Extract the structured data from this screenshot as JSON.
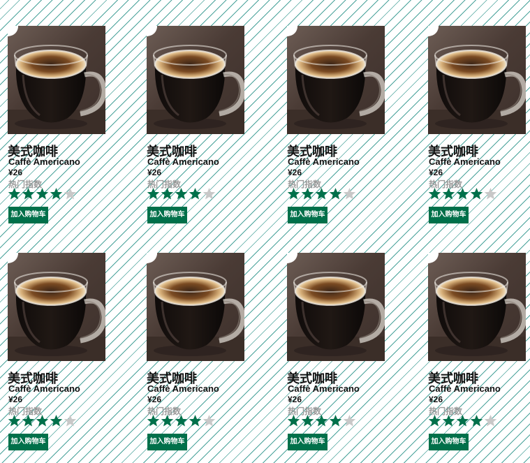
{
  "colors": {
    "accent": "#00704a",
    "star_filled": "#00704a",
    "star_empty": "#c8c8c8",
    "stripe": "#4aa39b"
  },
  "products": [
    {
      "name_cn": "美式咖啡",
      "name_en": "Caffè Americano",
      "price": "¥26",
      "hot_label": "热门指数",
      "rating": 4,
      "max_rating": 5,
      "cart_label": "加入购物车",
      "image_icon": "coffee-cup-photo"
    },
    {
      "name_cn": "美式咖啡",
      "name_en": "Caffè Americano",
      "price": "¥26",
      "hot_label": "热门指数",
      "rating": 4,
      "max_rating": 5,
      "cart_label": "加入购物车",
      "image_icon": "coffee-cup-photo"
    },
    {
      "name_cn": "美式咖啡",
      "name_en": "Caffè Americano",
      "price": "¥26",
      "hot_label": "热门指数",
      "rating": 4,
      "max_rating": 5,
      "cart_label": "加入购物车",
      "image_icon": "coffee-cup-photo"
    },
    {
      "name_cn": "美式咖啡",
      "name_en": "Caffè Americano",
      "price": "¥26",
      "hot_label": "热门指数",
      "rating": 4,
      "max_rating": 5,
      "cart_label": "加入购物车",
      "image_icon": "coffee-cup-photo"
    },
    {
      "name_cn": "美式咖啡",
      "name_en": "Caffè Americano",
      "price": "¥26",
      "hot_label": "热门指数",
      "rating": 4,
      "max_rating": 5,
      "cart_label": "加入购物车",
      "image_icon": "coffee-cup-photo"
    },
    {
      "name_cn": "美式咖啡",
      "name_en": "Caffè Americano",
      "price": "¥26",
      "hot_label": "热门指数",
      "rating": 4,
      "max_rating": 5,
      "cart_label": "加入购物车",
      "image_icon": "coffee-cup-photo"
    },
    {
      "name_cn": "美式咖啡",
      "name_en": "Caffè Americano",
      "price": "¥26",
      "hot_label": "热门指数",
      "rating": 4,
      "max_rating": 5,
      "cart_label": "加入购物车",
      "image_icon": "coffee-cup-photo"
    },
    {
      "name_cn": "美式咖啡",
      "name_en": "Caffè Americano",
      "price": "¥26",
      "hot_label": "热门指数",
      "rating": 4,
      "max_rating": 5,
      "cart_label": "加入购物车",
      "image_icon": "coffee-cup-photo"
    }
  ]
}
